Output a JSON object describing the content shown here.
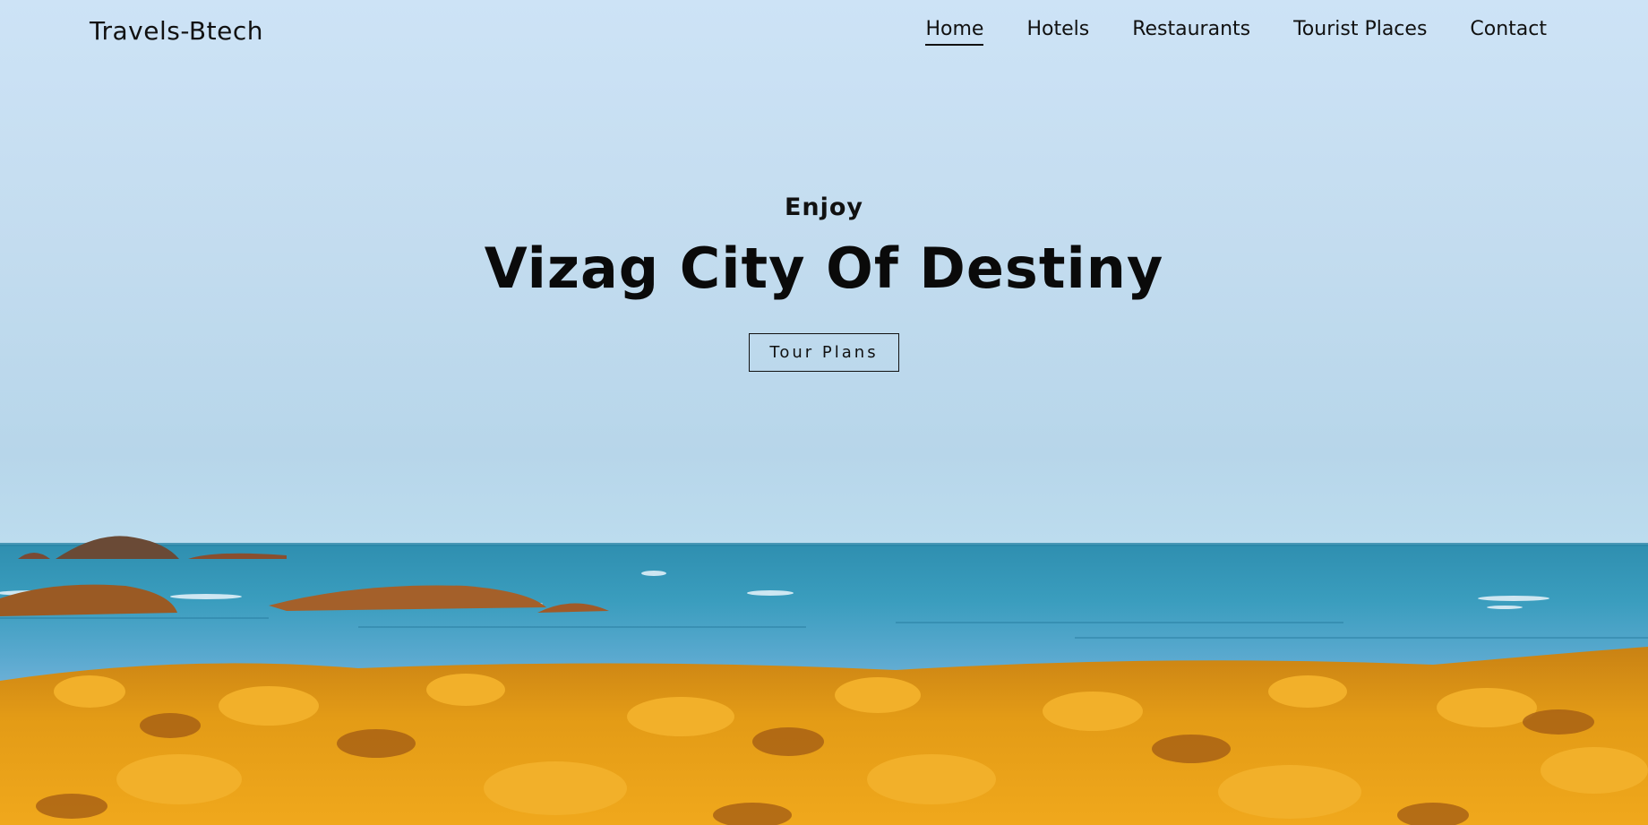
{
  "nav": {
    "brand": "Travels-Btech",
    "links": [
      {
        "label": "Home",
        "active": true
      },
      {
        "label": "Hotels",
        "active": false
      },
      {
        "label": "Restaurants",
        "active": false
      },
      {
        "label": "Tourist Places",
        "active": false
      },
      {
        "label": "Contact",
        "active": false
      }
    ]
  },
  "hero": {
    "eyebrow": "Enjoy",
    "title": "Vizag City Of Destiny",
    "cta_label": "Tour Plans"
  },
  "colors": {
    "sky": "#c3dcef",
    "sea": "#3b9ab8",
    "rocks": "#e59c12",
    "text": "#111111"
  }
}
